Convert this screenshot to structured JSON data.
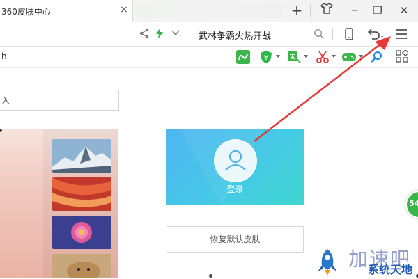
{
  "tabbar": {
    "tab_title": "360皮肤中心",
    "close_glyph": "×",
    "new_tab_glyph": "+",
    "skin_icon": "tshirt-icon",
    "restore_glyph": "❐",
    "close_window_glyph": "✕"
  },
  "addressbar": {
    "page_text": "武林争霸火热开战",
    "icons": [
      "share-icon",
      "bolt-icon",
      "chevron-down-icon",
      "search-icon",
      "phone-icon",
      "undo-icon",
      "menu-icon"
    ]
  },
  "bookmarks": {
    "fragment": "h",
    "extensions": [
      "wallpaper-ext-icon",
      "shield-ext-icon",
      "translate-ext-icon",
      "scissors-ext-icon",
      "game-ext-icon",
      "search-ext-icon",
      "apps-grid-icon"
    ]
  },
  "skin_center": {
    "search_fragment": "入",
    "login_label": "登录",
    "restore_default_label": "恢复默认皮肤",
    "thumbnails": [
      "snow-mountain",
      "red-canyon",
      "pink-flower",
      "dog"
    ]
  },
  "overlay": {
    "badge_text": "54",
    "watermark_cn": "加速吧",
    "watermark_site": "系统天地"
  },
  "colors": {
    "login_gradient_start": "#4fb5f2",
    "login_gradient_end": "#3fd7d0",
    "arrow_red": "#e53935",
    "accent_green": "#39b54a"
  }
}
